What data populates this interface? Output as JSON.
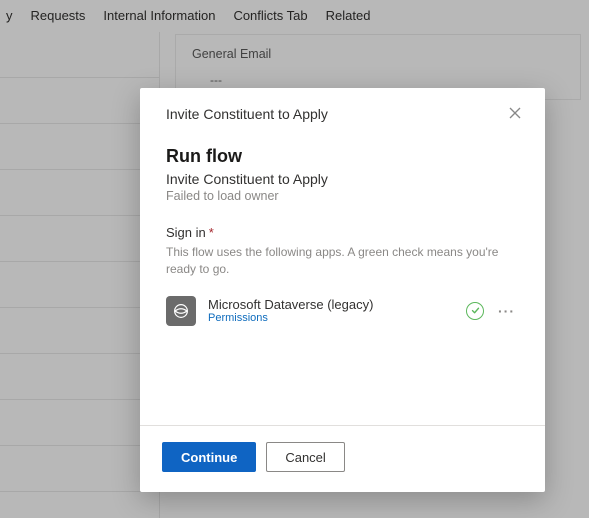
{
  "tabs": {
    "t1": "y",
    "t2": "Requests",
    "t3": "Internal Information",
    "t4": "Conflicts Tab",
    "t5": "Related"
  },
  "background": {
    "field_label": "General Email",
    "field_value": "---"
  },
  "dialog": {
    "title": "Invite Constituent to Apply",
    "run_heading": "Run flow",
    "flow_name": "Invite Constituent to Apply",
    "owner_error": "Failed to load owner",
    "signin_label": "Sign in",
    "required_mark": "*",
    "signin_desc": "This flow uses the following apps. A green check means you're ready to go.",
    "connection": {
      "name": "Microsoft Dataverse (legacy)",
      "permissions_link": "Permissions",
      "more_label": "···"
    },
    "buttons": {
      "continue": "Continue",
      "cancel": "Cancel"
    }
  }
}
